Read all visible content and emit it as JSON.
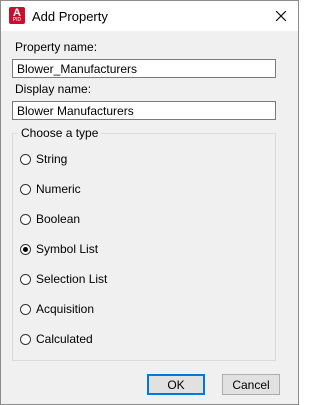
{
  "window": {
    "title": "Add Property",
    "app_icon_letter": "A",
    "app_icon_sub": "PID"
  },
  "fields": {
    "property_name_label": "Property name:",
    "property_name_value": "Blower_Manufacturers",
    "display_name_label": "Display name:",
    "display_name_value": "Blower Manufacturers"
  },
  "type_group": {
    "title": "Choose a type",
    "options": [
      {
        "label": "String",
        "checked": false
      },
      {
        "label": "Numeric",
        "checked": false
      },
      {
        "label": "Boolean",
        "checked": false
      },
      {
        "label": "Symbol List",
        "checked": true
      },
      {
        "label": "Selection List",
        "checked": false
      },
      {
        "label": "Acquisition",
        "checked": false
      },
      {
        "label": "Calculated",
        "checked": false
      }
    ]
  },
  "buttons": {
    "ok_label": "OK",
    "cancel_label": "Cancel"
  },
  "colors": {
    "app_icon": "#c8102e",
    "default_button_border": "#0078d7"
  }
}
